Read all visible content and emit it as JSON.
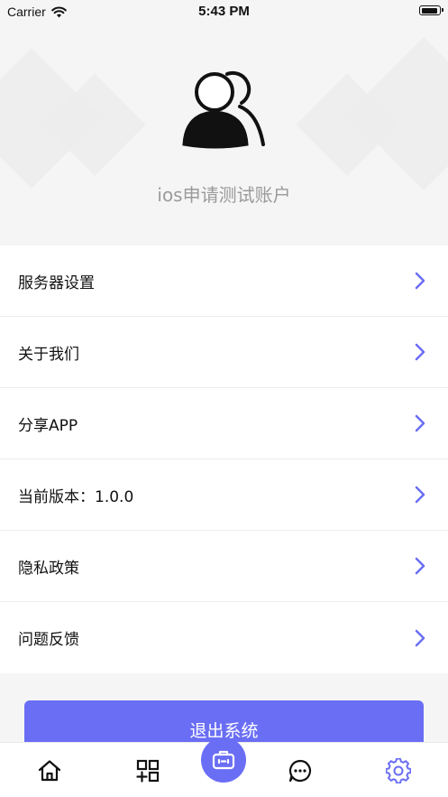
{
  "status_bar": {
    "carrier": "Carrier",
    "time": "5:43 PM"
  },
  "profile": {
    "avatar_icon": "users-icon",
    "account_name": "ios申请测试账户"
  },
  "menu": {
    "items": [
      {
        "label": "服务器设置"
      },
      {
        "label": "关于我们"
      },
      {
        "label": "分享APP"
      },
      {
        "label": "当前版本：1.0.0"
      },
      {
        "label": "隐私政策"
      },
      {
        "label": "问题反馈"
      }
    ],
    "chevron_color": "#6a6ef5"
  },
  "logout": {
    "label": "退出系统"
  },
  "tab_bar": {
    "tabs": [
      {
        "icon": "home-icon"
      },
      {
        "icon": "grid-plus-icon"
      },
      {
        "icon": "toolbox-icon"
      },
      {
        "icon": "chat-icon"
      },
      {
        "icon": "gear-icon",
        "active": true
      }
    ],
    "accent": "#6a6ef5"
  }
}
